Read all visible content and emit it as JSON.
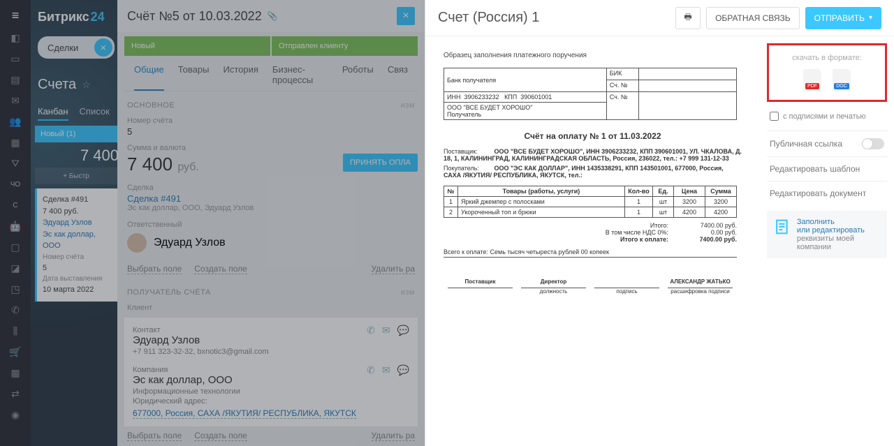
{
  "brand": {
    "a": "Битрикс",
    "b": "24"
  },
  "dealsTab": "Сделки",
  "panelTitle": "Счета",
  "viewTabs": {
    "kanban": "Канбан",
    "list": "Список"
  },
  "newPill": "Новый (1)",
  "kanbanTotal": "7 400",
  "quick": "+ Быстр",
  "miniCard": {
    "title": "Сделка #491",
    "sum": "7 400 руб.",
    "person": "Эдуард Узлов",
    "company": "Эс как доллар, ООО",
    "numLabel": "Номер счёта",
    "num": "5",
    "dateLabel": "Дата выставления",
    "date": "10 марта 2022"
  },
  "mid": {
    "title": "Счёт №5 от 10.03.2022",
    "stages": [
      "Новый",
      "Отправлен клиенту"
    ],
    "tabs": [
      "Общие",
      "Товары",
      "История",
      "Бизнес-процессы",
      "Роботы",
      "Связ"
    ],
    "sectionMain": "ОСНОВНОЕ",
    "edit": "изм",
    "numLabel": "Номер счёта",
    "num": "5",
    "sumLabel": "Сумма и валюта",
    "sum": "7 400",
    "cur": "руб.",
    "payBtn": "ПРИНЯТЬ ОПЛА",
    "dealLabel": "Сделка",
    "dealLink": "Сделка #491",
    "dealSub": "Эс как доллар, ООО, Эдуард Узлов",
    "respLabel": "Ответственный",
    "respName": "Эдуард Узлов",
    "selField": "Выбрать поле",
    "addField": "Создать поле",
    "delRow": "Удалить ра",
    "sectionRecipient": "ПОЛУЧАТЕЛЬ СЧЁТА",
    "clientLabel": "Клиент",
    "contactLabel": "Контакт",
    "contactName": "Эдуард Узлов",
    "contactSub": "+7 911 323-32-32, bxnotic3@gmail.com",
    "companyLabel": "Компания",
    "companyName": "Эс как доллар, ООО",
    "companySub": "Информационные технологии",
    "legalLabel": "Юридический адрес:",
    "legal": "677000, Россия, САХА /ЯКУТИЯ/ РЕСПУБЛИКА, ЯКУТСК"
  },
  "right": {
    "title": "Счет (Россия) 1",
    "feedback": "ОБРАТНАЯ СВЯЗЬ",
    "send": "ОТПРАВИТЬ",
    "dlTitle": "скачать в формате:",
    "pdf": "PDF",
    "doc": "DOC",
    "stamp": "с подписями и печатью",
    "publicLink": "Публичная ссылка",
    "editTpl": "Редактировать шаблон",
    "editDoc": "Редактировать документ",
    "fill1": "Заполнить",
    "fill2": "или редактировать",
    "fill3": "реквизиты моей компании"
  },
  "doc": {
    "caption": "Образец заполнения платежного поручения",
    "bankLabel": "Банк получателя",
    "bik": "БИК",
    "acct": "Сч. №",
    "inn": "ИНН",
    "innVal": "3906233232",
    "kpp": "КПП",
    "kppVal": "390601001",
    "recipient": "ООО \"ВСЕ БУДЕТ ХОРОШО\"",
    "recipientLabel": "Получатель",
    "title": "Счёт на оплату № 1 от 11.03.2022",
    "supplierLabel": "Поставщик:",
    "supplier": "ООО \"ВСЕ БУДЕТ ХОРОШО\", ИНН 3906233232, КПП 390601001, УЛ. ЧКАЛОВА, Д. 18, 1, КАЛИНИНГРАД, КАЛИНИНГРАДСКАЯ ОБЛАСТЬ, Россия, 236022, тел.: +7 999 131-12-33",
    "buyerLabel": "Покупатель:",
    "buyer": "ООО \"ЭС КАК ДОЛЛАР\", ИНН 1435338291, КПП 143501001, 677000, Россия, САХА /ЯКУТИЯ/ РЕСПУБЛИКА, ЯКУТСК, тел.:",
    "cols": {
      "n": "№",
      "name": "Товары (работы, услуги)",
      "qty": "Кол-во",
      "unit": "Ед.",
      "price": "Цена",
      "sum": "Сумма"
    },
    "items": [
      {
        "n": "1",
        "name": "Яркий джемпер с полосками",
        "qty": "1",
        "unit": "шт",
        "price": "3200",
        "sum": "3200"
      },
      {
        "n": "2",
        "name": "Укороченный топ и брюки",
        "qty": "1",
        "unit": "шт",
        "price": "4200",
        "sum": "4200"
      }
    ],
    "totals": {
      "itogo": "Итого:",
      "itogoV": "7400.00 руб.",
      "nds": "В том числе НДС 0%:",
      "ndsV": "0.00 руб.",
      "topay": "Итого к оплате:",
      "topayV": "7400.00 руб."
    },
    "words": "Всего к оплате: Семь тысяч четыреста рублей 00 копеек",
    "sig": {
      "supplier": "Поставщик",
      "director": "Директор",
      "position": "должность",
      "sign": "подпись",
      "name": "АЛЕКСАНДР ЖАТЬКО",
      "decode": "расшифровка подписи"
    }
  }
}
